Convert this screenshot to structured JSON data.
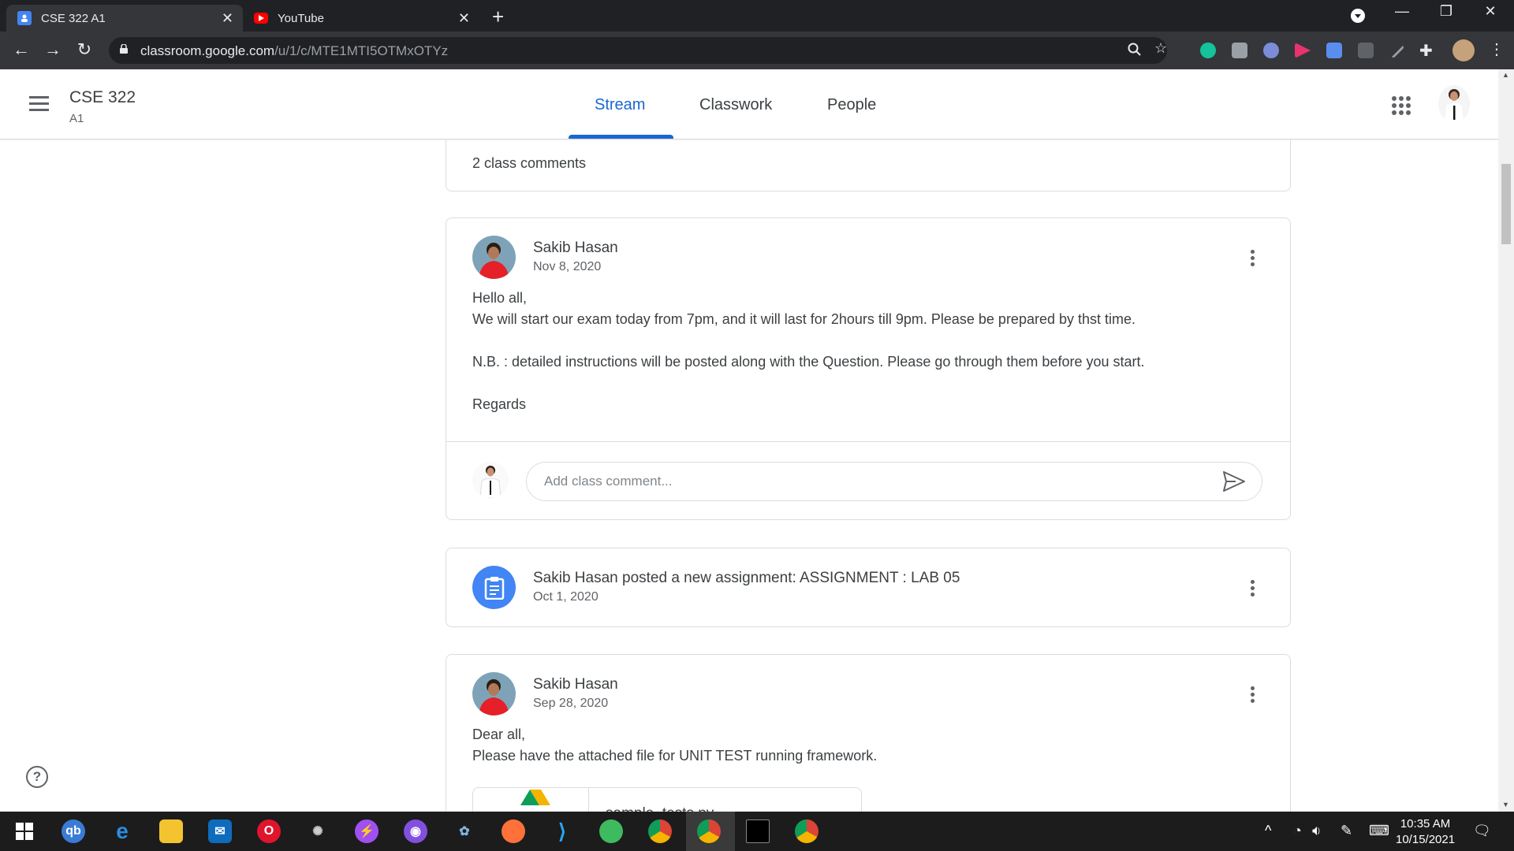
{
  "browser": {
    "tabs": [
      {
        "title": "CSE 322 A1",
        "favicon": "classroom-icon",
        "active": true
      },
      {
        "title": "YouTube",
        "favicon": "youtube-icon",
        "active": false
      }
    ],
    "url_main": "classroom.google.com",
    "url_path": "/u/1/c/MTE1MTI5OTMxOTYz"
  },
  "classroom": {
    "class_name": "CSE 322",
    "section": "A1",
    "nav_tabs": [
      "Stream",
      "Classwork",
      "People"
    ],
    "active_tab": "Stream"
  },
  "stream": {
    "prev_card": {
      "comments_label": "2 class comments"
    },
    "post1": {
      "author": "Sakib Hasan",
      "date": "Nov 8, 2020",
      "line1": "Hello all,",
      "line2": "We will start our exam today from 7pm, and it will last for 2hours till 9pm. Please be prepared by thst time.",
      "line3": "N.B. : detailed instructions will be posted along with the Question. Please go through them before you start.",
      "line4": "Regards",
      "comment_placeholder": "Add class comment..."
    },
    "assignment": {
      "title": "Sakib Hasan posted a new assignment: ASSIGNMENT : LAB 05",
      "date": "Oct 1, 2020"
    },
    "post2": {
      "author": "Sakib Hasan",
      "date": "Sep 28, 2020",
      "line1": "Dear all,",
      "line2": "Please have the attached file for UNIT TEST running framework.",
      "attachment_name": "sample_tests.py"
    }
  },
  "taskbar": {
    "time": "10:35 AM",
    "date": "10/15/2021"
  },
  "colors": {
    "accent": "#1967d2",
    "assignment_icon_bg": "#4285f4",
    "browser_dark": "#202124"
  }
}
